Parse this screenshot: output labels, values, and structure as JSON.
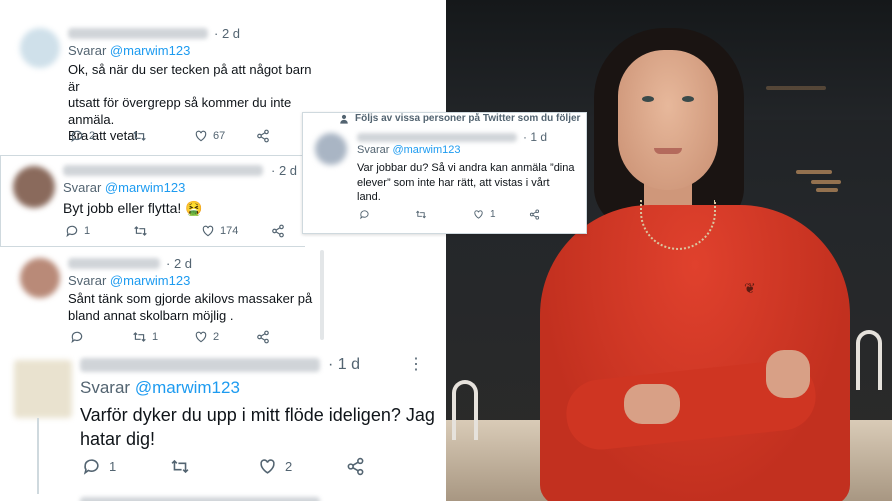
{
  "tweets": {
    "t1": {
      "handle_line": "Svarar",
      "handle": "@marwim123",
      "time": "· 2 d",
      "text": "Ok, så när du ser tecken på att något barn är\nutsatt för övergrepp så kommer du inte\nanmäla.\nBra att veta!",
      "replies": "2",
      "retweets": "",
      "likes": "67"
    },
    "t2": {
      "handle_line": "Svarar",
      "handle": "@marwim123",
      "time": "· 2 d",
      "text": "Byt jobb eller flytta! 🤮",
      "replies": "1",
      "retweets": "",
      "likes": "174"
    },
    "t3": {
      "followed_by": "Följs av vissa personer på Twitter som du följer",
      "handle_line": "Svarar",
      "handle": "@marwim123",
      "time": "· 1 d",
      "text": "Var jobbar du? Så vi andra kan anmäla ”dina\nelever” som inte har rätt, att vistas i vårt\nland.",
      "replies": "",
      "retweets": "",
      "likes": "1"
    },
    "t4": {
      "handle_line": "Svarar",
      "handle": "@marwim123",
      "time": "· 2 d",
      "text": "Sånt tänk som gjorde akilovs massaker på\nbland annat skolbarn möjlig .",
      "replies": "",
      "retweets": "1",
      "likes": "2"
    },
    "t5": {
      "handle_line": "Svarar",
      "handle": "@marwim123",
      "time": "· 1 d",
      "text": "Varför dyker du upp i mitt flöde ideligen? Jag\nhatar dig!",
      "replies": "1",
      "retweets": "",
      "likes": "2"
    }
  },
  "icons": {
    "reply": "reply-icon",
    "retweet": "retweet-icon",
    "like": "heart-icon",
    "share": "share-icon",
    "more": "more-icon",
    "person": "person-icon"
  },
  "colors": {
    "link": "#1d9bf0",
    "muted": "#536471",
    "text": "#0f1419",
    "sweater": "#c2301f"
  }
}
